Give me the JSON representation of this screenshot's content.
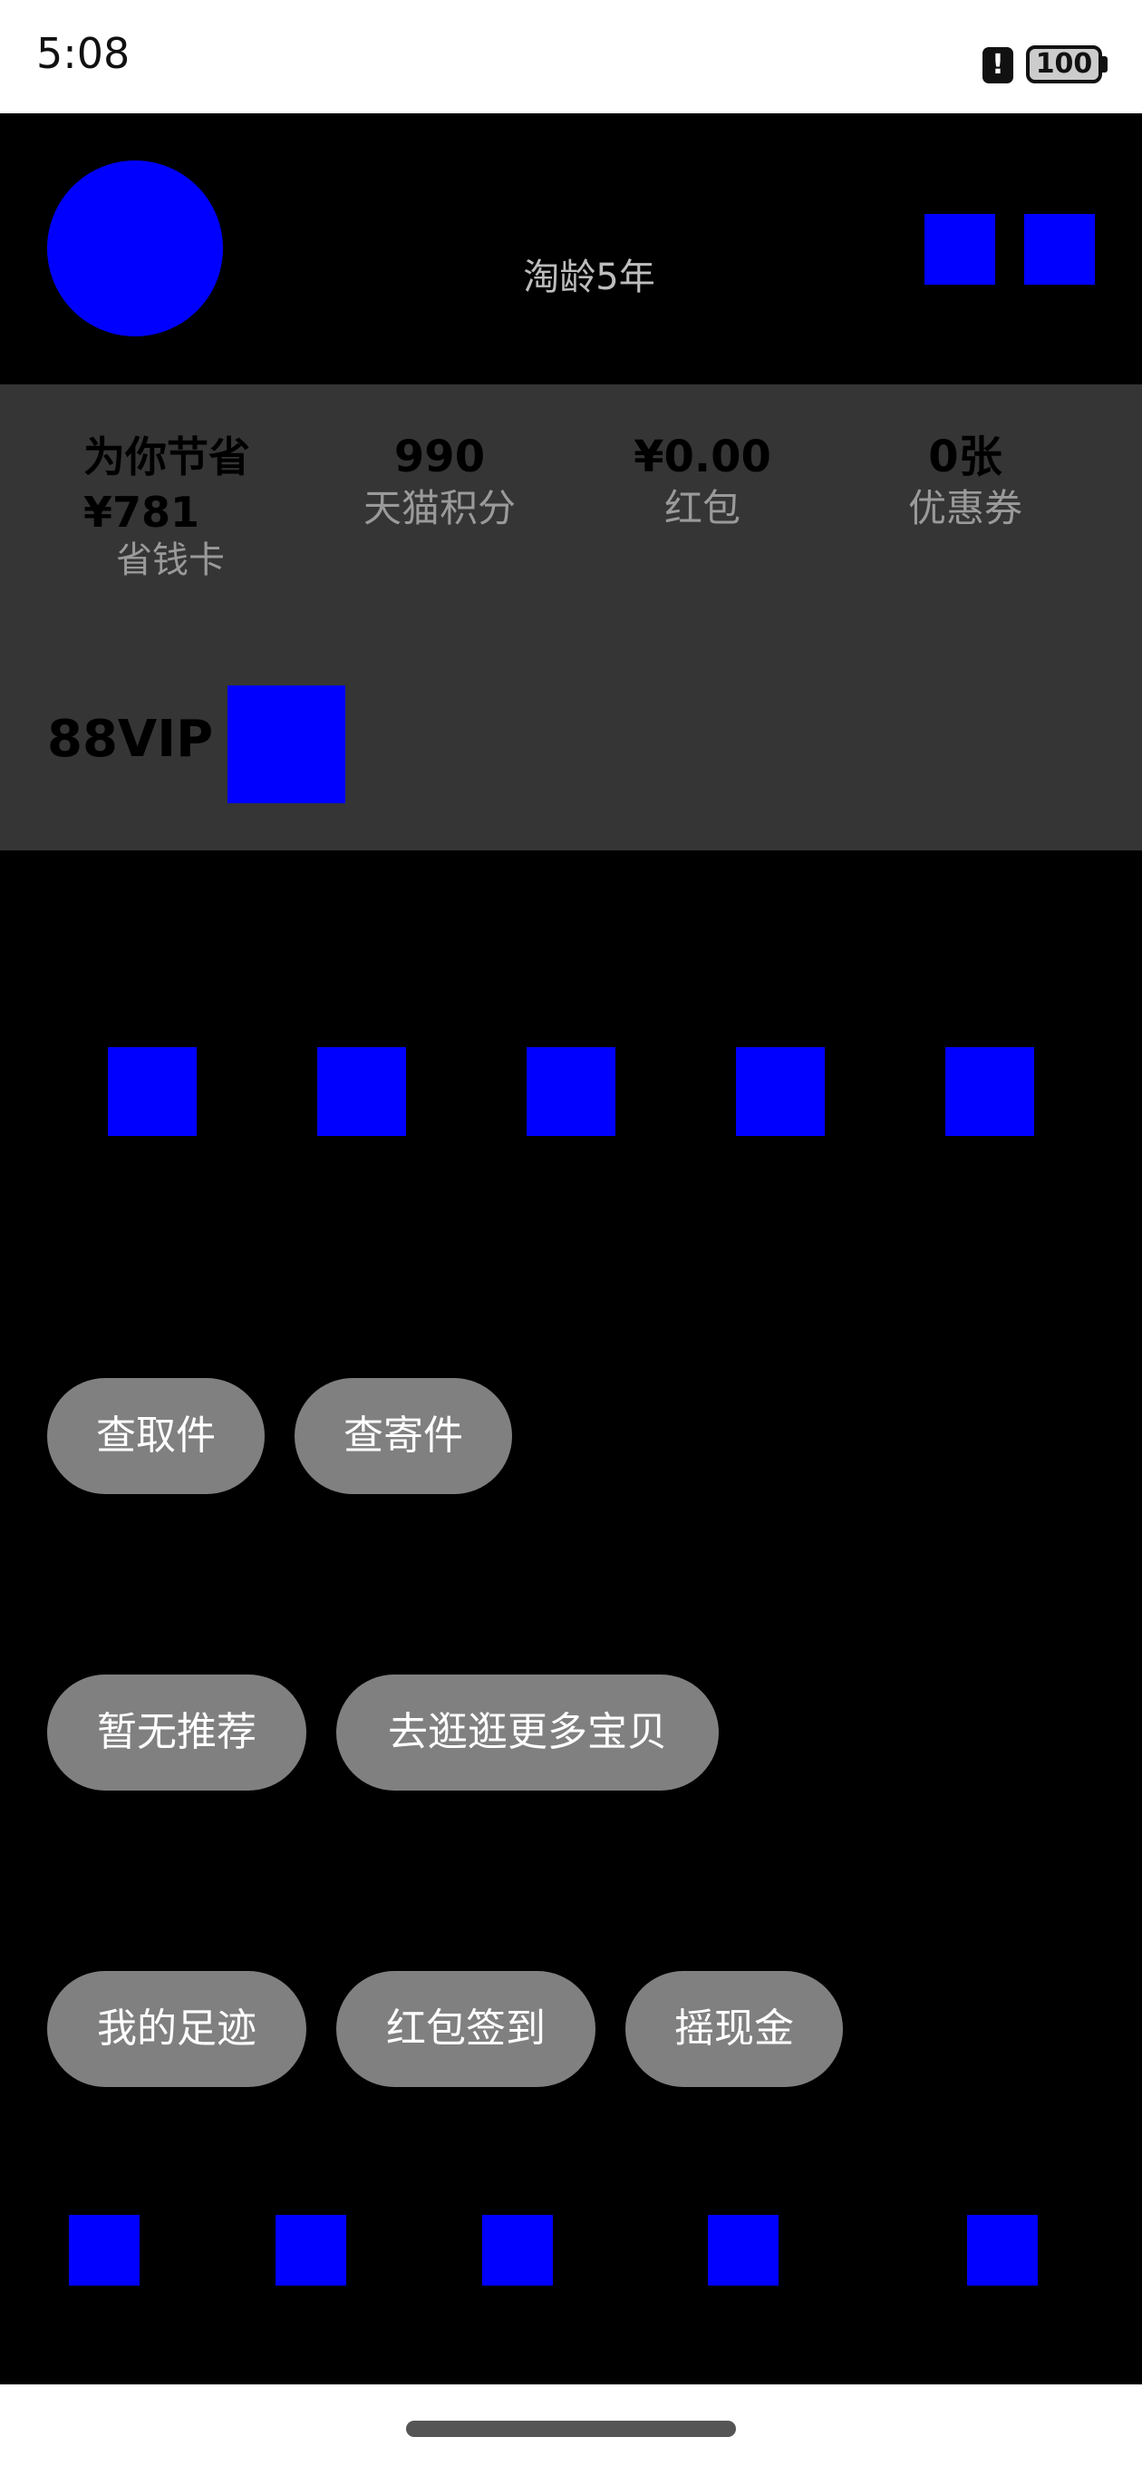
{
  "status_bar": {
    "time": "5:08",
    "alert_glyph": "!",
    "battery": "100"
  },
  "header": {
    "taobao_age": "淘龄5年",
    "icons": [
      "settings-icon",
      "message-icon"
    ]
  },
  "summary": {
    "savings_title": "为你节省\n¥781",
    "savings_label": "省钱卡",
    "stats": [
      {
        "value": "990",
        "label": "天猫积分"
      },
      {
        "value": "¥0.00",
        "label": "红包"
      },
      {
        "value": "0张",
        "label": "优惠券"
      }
    ],
    "vip_label": "88VIP"
  },
  "orders": {
    "icons": [
      "pending-payment-icon",
      "pending-shipment-icon",
      "pending-receipt-icon",
      "pending-review-icon",
      "refund-icon"
    ]
  },
  "logistics": {
    "buttons": [
      "查取件",
      "查寄件"
    ]
  },
  "recommendations": {
    "buttons": [
      "暂无推荐",
      "去逛逛更多宝贝"
    ]
  },
  "activities": {
    "buttons": [
      "我的足迹",
      "红包签到",
      "摇现金"
    ]
  },
  "tab_bar": {
    "icons": [
      "home-tab-icon",
      "video-tab-icon",
      "message-tab-icon",
      "cart-tab-icon",
      "profile-tab-icon"
    ]
  },
  "colors": {
    "placeholder": "#0000ff",
    "panel": "#353535",
    "pill": "#808080"
  }
}
